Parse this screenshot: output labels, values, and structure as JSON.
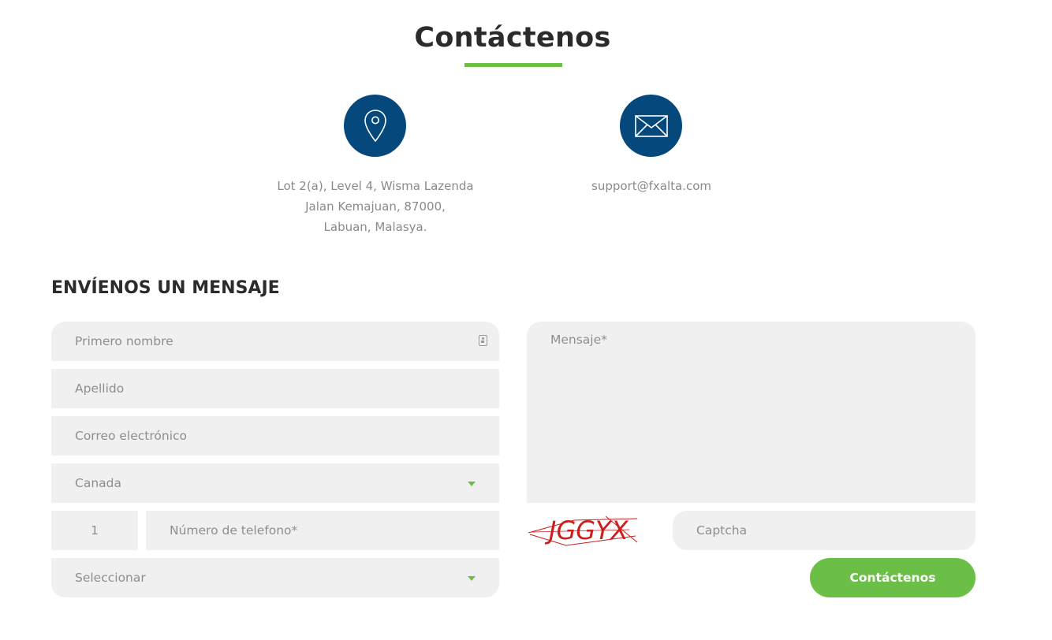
{
  "header": {
    "title": "Contáctenos"
  },
  "contact": {
    "address": {
      "icon": "location-pin-icon",
      "line1": "Lot 2(a), Level 4, Wisma Lazenda",
      "line2": "Jalan Kemajuan, 87000,",
      "line3": "Labuan, Malasya."
    },
    "email": {
      "icon": "envelope-icon",
      "value": "support@fxalta.com"
    }
  },
  "form": {
    "section_title": "ENVÍENOS UN MENSAJE",
    "first_name_placeholder": "Primero nombre",
    "last_name_placeholder": "Apellido",
    "email_placeholder": "Correo electrónico",
    "country_value": "Canada",
    "phone_code": "1",
    "phone_placeholder": "Número de telefono*",
    "select_value": "Seleccionar",
    "message_placeholder": "Mensaje*",
    "captcha_text": "JGGYX",
    "captcha_placeholder": "Captcha",
    "submit_label": "Contáctenos"
  },
  "colors": {
    "accent_green": "#6cbf46",
    "icon_blue": "#05487c",
    "field_bg": "#f0f0f0",
    "heading": "#2b2b2b"
  }
}
